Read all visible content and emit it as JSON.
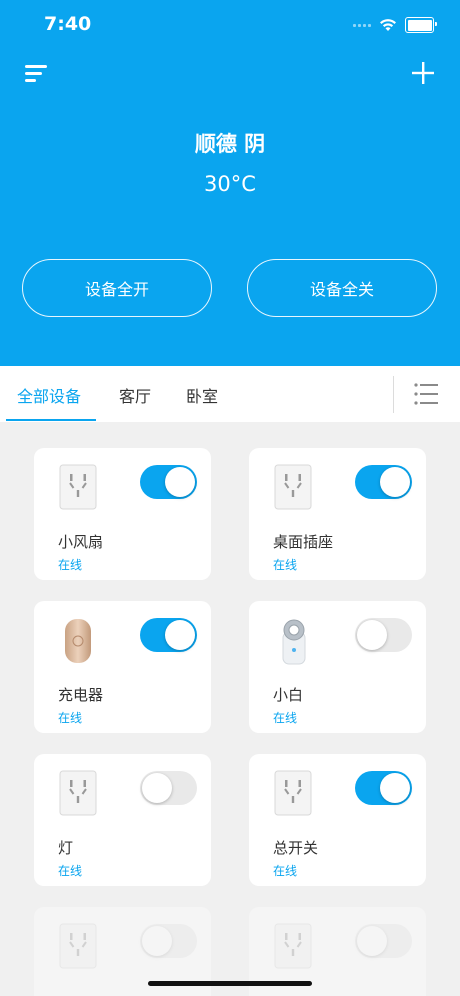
{
  "status_bar": {
    "time": "7:40"
  },
  "header": {
    "location": "顺德 阴",
    "temperature": "30°C",
    "all_on_label": "设备全开",
    "all_off_label": "设备全关"
  },
  "tabs": [
    {
      "label": "全部设备",
      "active": true
    },
    {
      "label": "客厅",
      "active": false
    },
    {
      "label": "卧室",
      "active": false
    }
  ],
  "devices": [
    {
      "name": "小风扇",
      "status": "在线",
      "on": true,
      "icon": "wall-socket-icon"
    },
    {
      "name": "桌面插座",
      "status": "在线",
      "on": true,
      "icon": "wall-socket-icon"
    },
    {
      "name": "充电器",
      "status": "在线",
      "on": true,
      "icon": "charger-icon"
    },
    {
      "name": "小白",
      "status": "在线",
      "on": false,
      "icon": "smart-plug-icon"
    },
    {
      "name": "灯",
      "status": "在线",
      "on": false,
      "icon": "wall-socket-icon"
    },
    {
      "name": "总开关",
      "status": "在线",
      "on": true,
      "icon": "wall-socket-icon"
    },
    {
      "name": "",
      "status": "",
      "on": false,
      "icon": "wall-socket-icon"
    },
    {
      "name": "",
      "status": "",
      "on": false,
      "icon": "wall-socket-icon"
    }
  ],
  "colors": {
    "accent": "#0aa5ef",
    "background": "#f0f0f0"
  }
}
